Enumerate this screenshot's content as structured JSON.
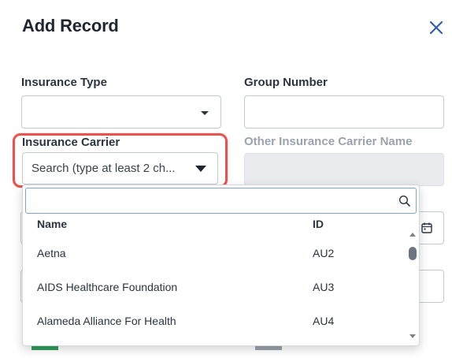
{
  "dialog": {
    "title": "Add Record",
    "close_icon": "close-icon"
  },
  "form": {
    "insurance_type": {
      "label": "Insurance Type",
      "value": ""
    },
    "group_number": {
      "label": "Group Number",
      "value": ""
    },
    "insurance_carrier": {
      "label": "Insurance Carrier",
      "placeholder": "Search (type at least 2 ch..."
    },
    "other_carrier": {
      "label": "Other Insurance Carrier Name",
      "value": ""
    }
  },
  "dropdown": {
    "search_value": "",
    "search_icon": "search-icon",
    "columns": {
      "name": "Name",
      "id": "ID"
    },
    "rows": [
      {
        "name": "Aetna",
        "id": "AU2"
      },
      {
        "name": "AIDS Healthcare Foundation",
        "id": "AU3"
      },
      {
        "name": "Alameda Alliance For Health",
        "id": "AU4"
      }
    ]
  },
  "colors": {
    "highlight": "#e8524f",
    "accent": "#2f5faa",
    "disabled_bg": "#e9ebee"
  }
}
